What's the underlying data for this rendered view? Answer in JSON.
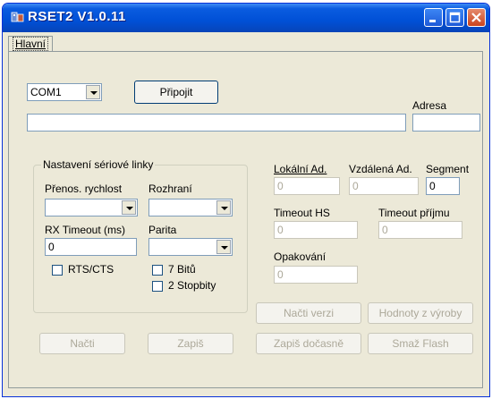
{
  "window": {
    "title": "RSET2 V1.0.11",
    "accent": "#0050d6"
  },
  "tabs": [
    {
      "label": "Hlavní"
    }
  ],
  "connection": {
    "port_value": "COM1",
    "connect_label": "Připojit",
    "address_label": "Adresa",
    "status_value": "",
    "address_value": ""
  },
  "serial": {
    "group_title": "Nastavení sériové linky",
    "baud_label": "Přenos. rychlost",
    "baud_value": "",
    "interface_label": "Rozhraní",
    "interface_value": "",
    "rx_timeout_label": "RX Timeout (ms)",
    "rx_timeout_value": "0",
    "parity_label": "Parita",
    "parity_value": "",
    "rts_cts_label": "RTS/CTS",
    "rts_cts_checked": false,
    "bits7_label": "7 Bitů",
    "bits7_checked": false,
    "stopbits2_label": "2 Stopbity",
    "stopbits2_checked": false
  },
  "device": {
    "local_addr_label": "Lokální Ad.",
    "local_addr_value": "0",
    "remote_addr_label": "Vzdálená Ad.",
    "remote_addr_value": "0",
    "segment_label": "Segment",
    "segment_value": "0",
    "timeout_hs_label": "Timeout HS",
    "timeout_hs_value": "0",
    "timeout_rx_label": "Timeout příjmu",
    "timeout_rx_value": "0",
    "retries_label": "Opakování",
    "retries_value": "0"
  },
  "actions": {
    "read_version": "Načti verzi",
    "factory_values": "Hodnoty z výroby",
    "read": "Načti",
    "write": "Zapiš",
    "write_temp": "Zapiš dočasně",
    "erase_flash": "Smaž Flash"
  }
}
